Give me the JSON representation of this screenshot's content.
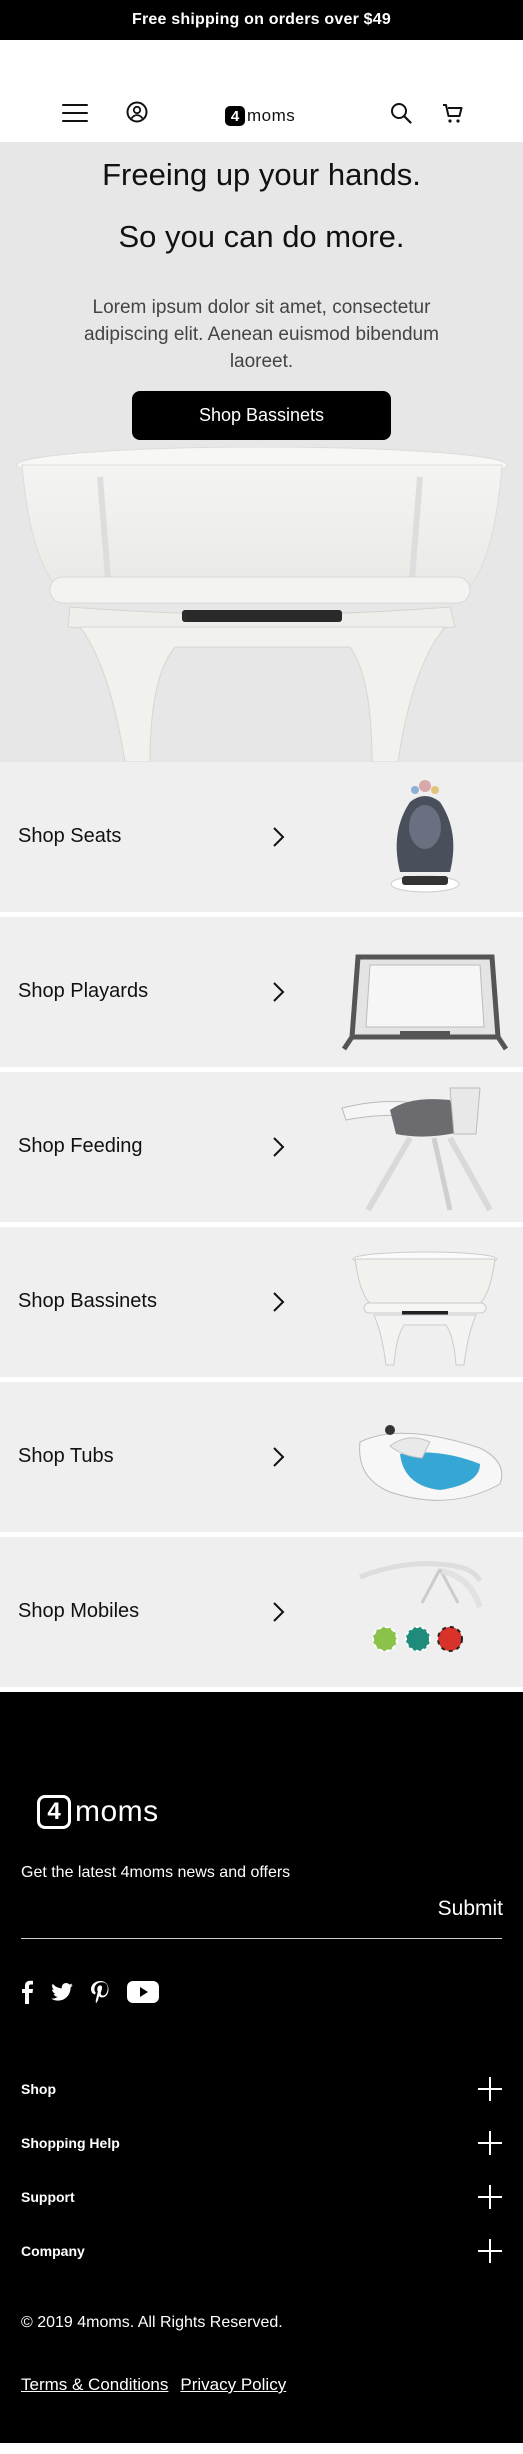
{
  "promo": {
    "text": "Free shipping on orders over $49"
  },
  "header": {
    "logo_badge": "4",
    "logo_word": "moms",
    "menu_icon": "hamburger-icon",
    "account_icon": "account-icon",
    "search_icon": "search-icon",
    "cart_icon": "cart-icon"
  },
  "hero": {
    "headline_1": "Freeing up your hands.",
    "headline_2": "So you can do more.",
    "body": "Lorem ipsum dolor sit amet, consectetur adipiscing elit. Aenean euismod bibendum laoreet.",
    "cta": "Shop Bassinets"
  },
  "shop_rows": [
    {
      "label": "Shop Seats",
      "image": "rocker-seat"
    },
    {
      "label": "Shop Playards",
      "image": "playard"
    },
    {
      "label": "Shop Feeding",
      "image": "high-chair"
    },
    {
      "label": "Shop Bassinets",
      "image": "bassinet"
    },
    {
      "label": "Shop Tubs",
      "image": "baby-tub"
    },
    {
      "label": "Shop Mobiles",
      "image": "mobile"
    }
  ],
  "footer": {
    "logo_badge": "4",
    "logo_word": "moms",
    "newsletter_text": "Get the latest 4moms news and offers",
    "email_placeholder": "",
    "submit_label": "Submit",
    "social": [
      "facebook-icon",
      "twitter-icon",
      "pinterest-icon",
      "youtube-icon"
    ],
    "accordions": [
      "Shop",
      "Shopping Help",
      "Support",
      "Company"
    ],
    "copyright": "© 2019 4moms. All Rights Reserved.",
    "terms": "Terms & Conditions",
    "privacy": "Privacy Policy"
  },
  "colors": {
    "promo_bg": "#000000",
    "hero_bg": "#e7e7e7",
    "row_bg": "#efefef",
    "footer_bg": "#000000",
    "button_bg": "#000000"
  }
}
